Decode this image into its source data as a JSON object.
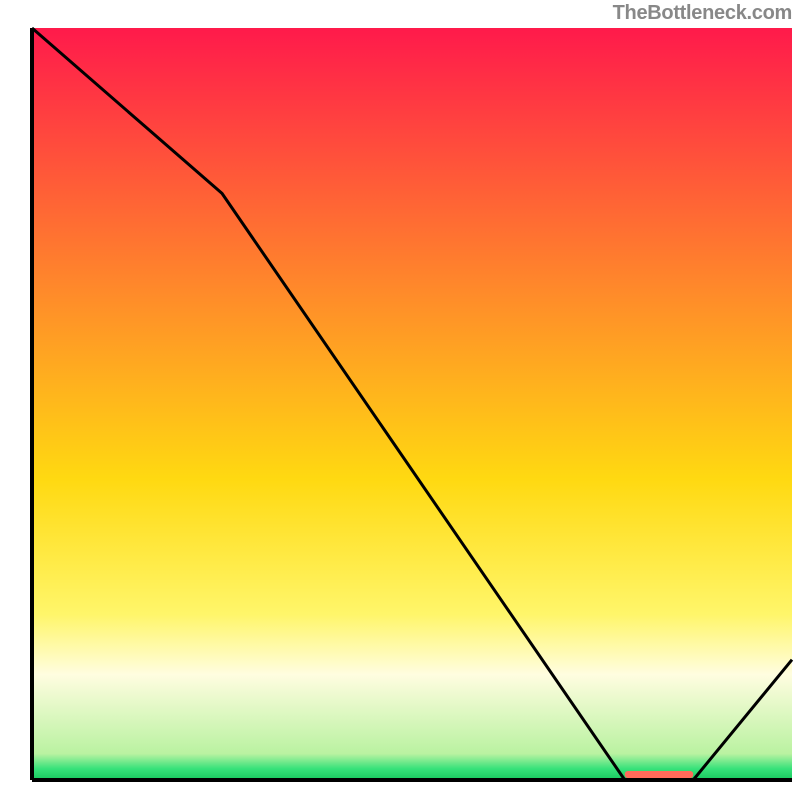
{
  "attribution": "TheBottleneck.com",
  "chart_data": {
    "type": "line",
    "title": "",
    "xlabel": "",
    "ylabel": "",
    "xlim": [
      0,
      100
    ],
    "ylim": [
      0,
      100
    ],
    "x": [
      0,
      25,
      78,
      87,
      100
    ],
    "values": [
      100,
      78,
      0,
      0,
      16
    ],
    "optimal_marker": {
      "x_start": 78,
      "x_end": 87,
      "color": "#ff6a5a"
    },
    "gradient_stops": [
      {
        "offset": 0.0,
        "color": "#ff1a4b"
      },
      {
        "offset": 0.35,
        "color": "#ff8a2a"
      },
      {
        "offset": 0.6,
        "color": "#ffd911"
      },
      {
        "offset": 0.78,
        "color": "#fff66a"
      },
      {
        "offset": 0.86,
        "color": "#fffde0"
      },
      {
        "offset": 0.965,
        "color": "#baf2a1"
      },
      {
        "offset": 0.985,
        "color": "#37e27a"
      },
      {
        "offset": 1.0,
        "color": "#18c85e"
      }
    ],
    "axis_color": "#000000",
    "line_color": "#000000"
  }
}
